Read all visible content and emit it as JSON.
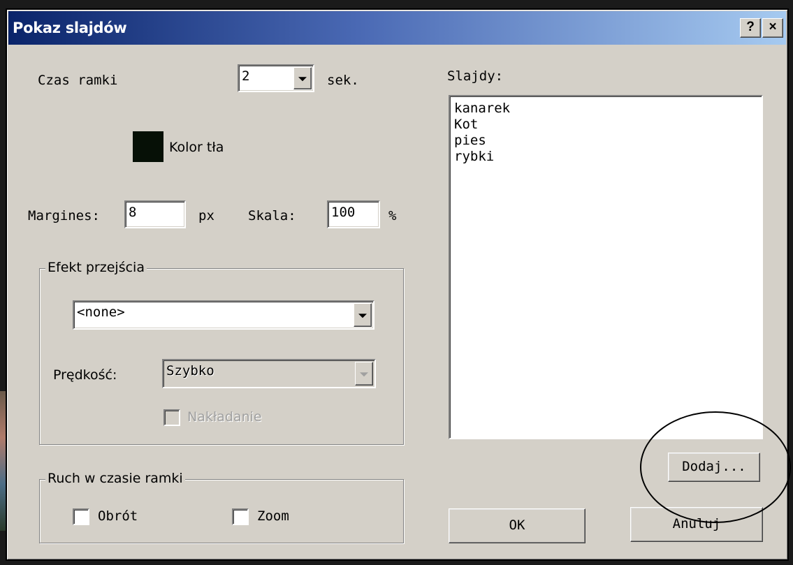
{
  "window": {
    "title": "Pokaz slajdów",
    "help_label": "?",
    "close_label": "×"
  },
  "frame_time": {
    "label": "Czas ramki",
    "value": "2",
    "unit": "sek."
  },
  "background_color": {
    "label": "Kolor tła",
    "swatch_color": "#061006"
  },
  "margin": {
    "label": "Margines:",
    "value": "8",
    "unit": "px"
  },
  "scale": {
    "label": "Skala:",
    "value": "100",
    "unit": "%"
  },
  "transition_group": {
    "title": "Efekt przejścia",
    "effect_value": "<none>",
    "speed_label": "Prędkość:",
    "speed_value": "Szybko",
    "overlap_label": "Nakładanie",
    "overlap_checked": false
  },
  "motion_group": {
    "title": "Ruch w czasie ramki",
    "rotation_label": "Obrót",
    "rotation_checked": false,
    "zoom_label": "Zoom",
    "zoom_checked": false
  },
  "slides": {
    "label": "Slajdy:",
    "items": [
      "kanarek",
      "Kot",
      "pies",
      "rybki"
    ]
  },
  "buttons": {
    "add": "Dodaj...",
    "ok": "OK",
    "cancel": "Anuluj"
  }
}
